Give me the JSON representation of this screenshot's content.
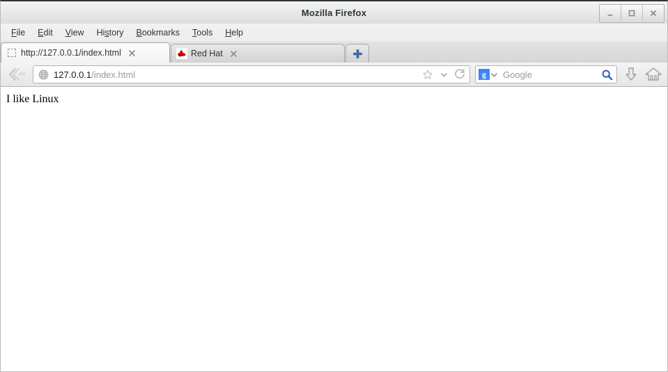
{
  "window": {
    "title": "Mozilla Firefox",
    "controls": {
      "minimize": "_",
      "maximize": "□",
      "close": "✕"
    }
  },
  "menubar": {
    "items": [
      {
        "label": "File",
        "mnemonic": "F"
      },
      {
        "label": "Edit",
        "mnemonic": "E"
      },
      {
        "label": "View",
        "mnemonic": "V"
      },
      {
        "label": "History",
        "mnemonic": "s"
      },
      {
        "label": "Bookmarks",
        "mnemonic": "B"
      },
      {
        "label": "Tools",
        "mnemonic": "T"
      },
      {
        "label": "Help",
        "mnemonic": "H"
      }
    ]
  },
  "tabs": {
    "items": [
      {
        "label": "http://127.0.0.1/index.html",
        "favicon": "placeholder-favicon-icon",
        "active": true,
        "close_label": "✕"
      },
      {
        "label": "Red Hat",
        "favicon": "red-hat-shadowman-icon",
        "active": false,
        "close_label": "✕"
      }
    ],
    "new_tab_label": "+"
  },
  "navbar": {
    "back_forward_icon": "back-arrow-icon",
    "url": {
      "identity_icon": "globe-icon",
      "host": "127.0.0.1",
      "path": "/index.html",
      "full_value": "127.0.0.1/index.html",
      "bookmark_icon": "star-icon",
      "dropdown_icon": "chevron-down-icon",
      "reload_icon": "reload-icon"
    },
    "search": {
      "engine": "Google",
      "engine_icon": "google-icon",
      "engine_letter": "g",
      "dropdown_icon": "chevron-down-icon",
      "placeholder": "Google",
      "submit_icon": "magnifier-icon"
    },
    "downloads_icon": "download-arrow-icon",
    "home_icon": "home-icon"
  },
  "page": {
    "body_text": "I like Linux"
  },
  "colors": {
    "accent_blue": "#4285f4",
    "red_hat_red": "#cc0000",
    "titlebar": "#ebebeb",
    "toolbar": "#ececec",
    "content_bg": "#ffffff"
  }
}
